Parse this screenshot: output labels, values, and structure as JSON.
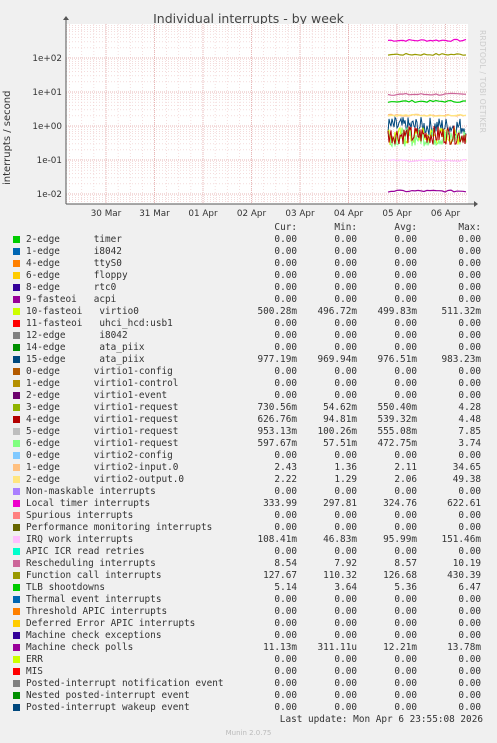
{
  "title": "Individual interrupts - by week",
  "watermark": "RRDTOOL / TOBI OETIKER",
  "footer": {
    "last_update": "Last update: Mon Apr  6 23:55:08 2026",
    "munin": "Munin 2.0.75"
  },
  "legend_headers": {
    "cur": "Cur:",
    "min": "Min:",
    "avg": "Avg:",
    "max": "Max:"
  },
  "legend": [
    {
      "name": "2-edge      timer",
      "color": "#00cc00",
      "cur": "0.00",
      "min": "0.00",
      "avg": "0.00",
      "max": "0.00"
    },
    {
      "name": "1-edge      i8042",
      "color": "#0066b3",
      "cur": "0.00",
      "min": "0.00",
      "avg": "0.00",
      "max": "0.00"
    },
    {
      "name": "4-edge      ttyS0",
      "color": "#ff8000",
      "cur": "0.00",
      "min": "0.00",
      "avg": "0.00",
      "max": "0.00"
    },
    {
      "name": "6-edge      floppy",
      "color": "#ffcc00",
      "cur": "0.00",
      "min": "0.00",
      "avg": "0.00",
      "max": "0.00"
    },
    {
      "name": "8-edge      rtc0",
      "color": "#330099",
      "cur": "0.00",
      "min": "0.00",
      "avg": "0.00",
      "max": "0.00"
    },
    {
      "name": "9-fasteoi   acpi",
      "color": "#990099",
      "cur": "0.00",
      "min": "0.00",
      "avg": "0.00",
      "max": "0.00"
    },
    {
      "name": "10-fasteoi   virtio0",
      "color": "#ccff00",
      "cur": "500.28m",
      "min": "496.72m",
      "avg": "499.83m",
      "max": "511.32m"
    },
    {
      "name": "11-fasteoi   uhci_hcd:usb1",
      "color": "#ff0000",
      "cur": "0.00",
      "min": "0.00",
      "avg": "0.00",
      "max": "0.00"
    },
    {
      "name": "12-edge      i8042",
      "color": "#808080",
      "cur": "0.00",
      "min": "0.00",
      "avg": "0.00",
      "max": "0.00"
    },
    {
      "name": "14-edge      ata_piix",
      "color": "#008f00",
      "cur": "0.00",
      "min": "0.00",
      "avg": "0.00",
      "max": "0.00"
    },
    {
      "name": "15-edge      ata_piix",
      "color": "#00487d",
      "cur": "977.19m",
      "min": "969.94m",
      "avg": "976.51m",
      "max": "983.23m"
    },
    {
      "name": "0-edge      virtio1-config",
      "color": "#b35a00",
      "cur": "0.00",
      "min": "0.00",
      "avg": "0.00",
      "max": "0.00"
    },
    {
      "name": "1-edge      virtio1-control",
      "color": "#b38f00",
      "cur": "0.00",
      "min": "0.00",
      "avg": "0.00",
      "max": "0.00"
    },
    {
      "name": "2-edge      virtio1-event",
      "color": "#6b006b",
      "cur": "0.00",
      "min": "0.00",
      "avg": "0.00",
      "max": "0.00"
    },
    {
      "name": "3-edge      virtio1-request",
      "color": "#8fb300",
      "cur": "730.56m",
      "min": "54.62m",
      "avg": "550.40m",
      "max": "4.28"
    },
    {
      "name": "4-edge      virtio1-request",
      "color": "#b30000",
      "cur": "626.76m",
      "min": "94.81m",
      "avg": "539.32m",
      "max": "4.48"
    },
    {
      "name": "5-edge      virtio1-request",
      "color": "#bebebe",
      "cur": "953.13m",
      "min": "100.26m",
      "avg": "555.08m",
      "max": "7.85"
    },
    {
      "name": "6-edge      virtio1-request",
      "color": "#80ff80",
      "cur": "597.67m",
      "min": "57.51m",
      "avg": "472.75m",
      "max": "3.74"
    },
    {
      "name": "0-edge      virtio2-config",
      "color": "#80c9ff",
      "cur": "0.00",
      "min": "0.00",
      "avg": "0.00",
      "max": "0.00"
    },
    {
      "name": "1-edge      virtio2-input.0",
      "color": "#ffc080",
      "cur": "2.43",
      "min": "1.36",
      "avg": "2.11",
      "max": "34.65"
    },
    {
      "name": "2-edge      virtio2-output.0",
      "color": "#ffe680",
      "cur": "2.22",
      "min": "1.29",
      "avg": "2.06",
      "max": "49.38"
    },
    {
      "name": "Non-maskable interrupts",
      "color": "#aa80ff",
      "cur": "0.00",
      "min": "0.00",
      "avg": "0.00",
      "max": "0.00"
    },
    {
      "name": "Local timer interrupts",
      "color": "#ee00cc",
      "cur": "333.99",
      "min": "297.81",
      "avg": "324.76",
      "max": "622.61"
    },
    {
      "name": "Spurious interrupts",
      "color": "#ff8080",
      "cur": "0.00",
      "min": "0.00",
      "avg": "0.00",
      "max": "0.00"
    },
    {
      "name": "Performance monitoring interrupts",
      "color": "#666600",
      "cur": "0.00",
      "min": "0.00",
      "avg": "0.00",
      "max": "0.00"
    },
    {
      "name": "IRQ work interrupts",
      "color": "#ffbfff",
      "cur": "108.41m",
      "min": "46.83m",
      "avg": "95.99m",
      "max": "151.46m"
    },
    {
      "name": "APIC ICR read retries",
      "color": "#00ffcc",
      "cur": "0.00",
      "min": "0.00",
      "avg": "0.00",
      "max": "0.00"
    },
    {
      "name": "Rescheduling interrupts",
      "color": "#cc6699",
      "cur": "8.54",
      "min": "7.92",
      "avg": "8.57",
      "max": "10.19"
    },
    {
      "name": "Function call interrupts",
      "color": "#999900",
      "cur": "127.67",
      "min": "110.32",
      "avg": "126.68",
      "max": "430.39"
    },
    {
      "name": "TLB shootdowns",
      "color": "#00cc00",
      "cur": "5.14",
      "min": "3.64",
      "avg": "5.36",
      "max": "6.47"
    },
    {
      "name": "Thermal event interrupts",
      "color": "#0066b3",
      "cur": "0.00",
      "min": "0.00",
      "avg": "0.00",
      "max": "0.00"
    },
    {
      "name": "Threshold APIC interrupts",
      "color": "#ff8000",
      "cur": "0.00",
      "min": "0.00",
      "avg": "0.00",
      "max": "0.00"
    },
    {
      "name": "Deferred Error APIC interrupts",
      "color": "#ffcc00",
      "cur": "0.00",
      "min": "0.00",
      "avg": "0.00",
      "max": "0.00"
    },
    {
      "name": "Machine check exceptions",
      "color": "#330099",
      "cur": "0.00",
      "min": "0.00",
      "avg": "0.00",
      "max": "0.00"
    },
    {
      "name": "Machine check polls",
      "color": "#990099",
      "cur": "11.13m",
      "min": "311.11u",
      "avg": "12.21m",
      "max": "13.78m"
    },
    {
      "name": "ERR",
      "color": "#ccff00",
      "cur": "0.00",
      "min": "0.00",
      "avg": "0.00",
      "max": "0.00"
    },
    {
      "name": "MIS",
      "color": "#ff0000",
      "cur": "0.00",
      "min": "0.00",
      "avg": "0.00",
      "max": "0.00"
    },
    {
      "name": "Posted-interrupt notification event",
      "color": "#808080",
      "cur": "0.00",
      "min": "0.00",
      "avg": "0.00",
      "max": "0.00"
    },
    {
      "name": "Nested posted-interrupt event",
      "color": "#008f00",
      "cur": "0.00",
      "min": "0.00",
      "avg": "0.00",
      "max": "0.00"
    },
    {
      "name": "Posted-interrupt wakeup event",
      "color": "#00487d",
      "cur": "0.00",
      "min": "0.00",
      "avg": "0.00",
      "max": "0.00"
    }
  ],
  "chart_data": {
    "type": "line",
    "title": "Individual interrupts - by week",
    "ylabel": "interrupts / second",
    "yscale": "log",
    "ylim": [
      0.005,
      1000
    ],
    "y_ticks": [
      "1e-02",
      "1e-01",
      "1e+00",
      "1e+01",
      "1e+02"
    ],
    "x_ticks": [
      "30 Mar",
      "31 Mar",
      "01 Apr",
      "02 Apr",
      "03 Apr",
      "04 Apr",
      "05 Apr",
      "06 Apr"
    ],
    "grid": true,
    "data_starts": "05 Apr",
    "series": [
      {
        "name": "Local timer interrupts",
        "color": "#ee00cc",
        "value": 330
      },
      {
        "name": "Function call interrupts",
        "color": "#999900",
        "value": 127
      },
      {
        "name": "Rescheduling interrupts",
        "color": "#cc6699",
        "value": 8.5
      },
      {
        "name": "TLB shootdowns",
        "color": "#00cc00",
        "value": 5.3
      },
      {
        "name": "1-edge      virtio2-input.0",
        "color": "#ffc080",
        "value": 2.1
      },
      {
        "name": "2-edge      virtio2-output.0",
        "color": "#ffe680",
        "value": 2.06
      },
      {
        "name": "15-edge      ata_piix",
        "color": "#00487d",
        "value": 0.977
      },
      {
        "name": "10-fasteoi   virtio0",
        "color": "#ccff00",
        "value": 0.5
      },
      {
        "name": "6-edge      virtio1-request",
        "color": "#80ff80",
        "value": 0.47
      },
      {
        "name": "4-edge      virtio1-request",
        "color": "#b30000",
        "value": 0.54
      },
      {
        "name": "IRQ work interrupts",
        "color": "#ffbfff",
        "value": 0.096
      },
      {
        "name": "Machine check polls",
        "color": "#990099",
        "value": 0.0122
      }
    ]
  }
}
